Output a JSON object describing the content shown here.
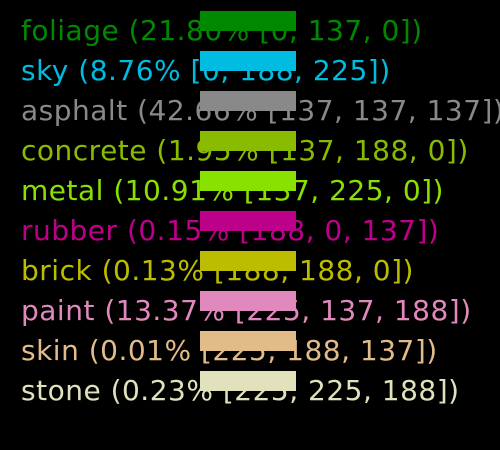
{
  "legend": {
    "items": [
      {
        "label": "foliage (21.80% [0, 137, 0])",
        "color": "#008900"
      },
      {
        "label": "sky (8.76% [0, 188, 225])",
        "color": "#00BCE1"
      },
      {
        "label": "asphalt (42.66% [137, 137, 137])",
        "color": "#898989"
      },
      {
        "label": "concrete (1.95% [137, 188, 0])",
        "color": "#89BC00"
      },
      {
        "label": "metal (10.91% [137, 225, 0])",
        "color": "#89E100"
      },
      {
        "label": "rubber (0.15% [188, 0, 137])",
        "color": "#BC0089"
      },
      {
        "label": "brick (0.13% [188, 188, 0])",
        "color": "#BCBC00"
      },
      {
        "label": "paint (13.37% [225, 137, 188])",
        "color": "#E189BC"
      },
      {
        "label": "skin (0.01% [225, 188, 137])",
        "color": "#E1BC89"
      },
      {
        "label": "stone (0.23% [225, 225, 188])",
        "color": "#E1E1BC"
      }
    ]
  }
}
